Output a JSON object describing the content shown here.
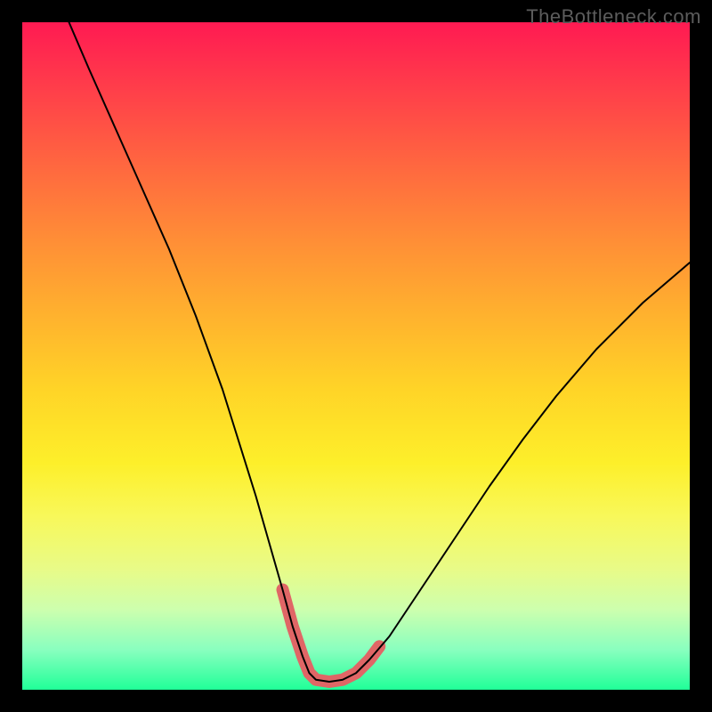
{
  "watermark": "TheBottleneck.com",
  "chart_data": {
    "type": "line",
    "title": "",
    "xlabel": "",
    "ylabel": "",
    "xlim": [
      0,
      100
    ],
    "ylim": [
      0,
      100
    ],
    "series": [
      {
        "name": "main-curve",
        "x": [
          7,
          10,
          14,
          18,
          22,
          26,
          30,
          32.5,
          35,
          37,
          39,
          40.5,
          42,
          43,
          44,
          46,
          48,
          50,
          52,
          55,
          58,
          62,
          66,
          70,
          75,
          80,
          86,
          93,
          100
        ],
        "y": [
          100,
          93,
          84,
          75,
          66,
          56,
          45,
          37,
          29,
          22,
          15,
          9.5,
          5,
          2.5,
          1.5,
          1.2,
          1.5,
          2.5,
          4.5,
          8,
          12.5,
          18.5,
          24.5,
          30.5,
          37.5,
          44,
          51,
          58,
          64
        ],
        "color": "#000000",
        "stroke_width": 2
      },
      {
        "name": "highlight-zone",
        "x": [
          39,
          40.5,
          42,
          43,
          44,
          46,
          48,
          50,
          52,
          53.5
        ],
        "y": [
          15,
          9.5,
          5,
          2.5,
          1.5,
          1.2,
          1.5,
          2.5,
          4.5,
          6.5
        ],
        "color": "#e06666",
        "stroke_width": 14
      }
    ],
    "background_gradient": {
      "top_color": "#ff1a52",
      "bottom_color": "#20ff98"
    }
  }
}
